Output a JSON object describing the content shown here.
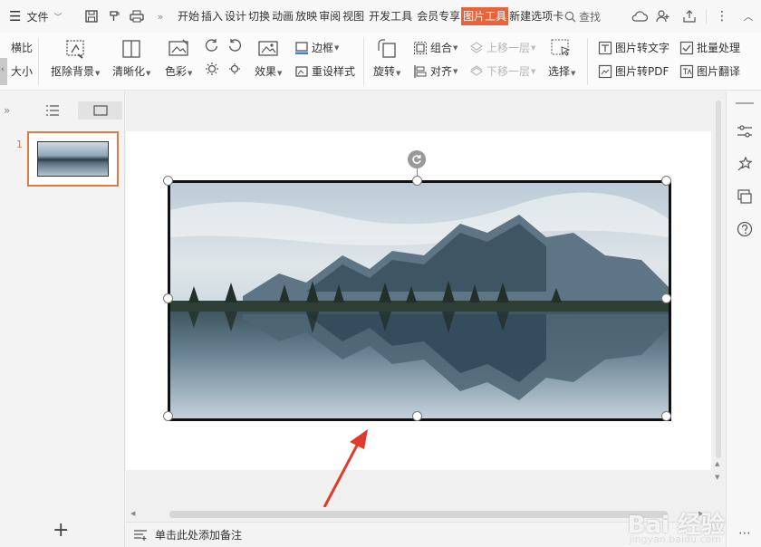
{
  "menubar": {
    "file_label": "文件",
    "tabs": [
      {
        "label": "开始"
      },
      {
        "label": "插入"
      },
      {
        "label": "设计"
      },
      {
        "label": "切换"
      },
      {
        "label": "动画"
      },
      {
        "label": "放映"
      },
      {
        "label": "审阅"
      },
      {
        "label": "视图"
      },
      {
        "label": "开发工具"
      },
      {
        "label": "会员专享"
      },
      {
        "label": "图片工具"
      },
      {
        "label": "新建选项卡"
      }
    ],
    "search_label": "查找"
  },
  "ribbon": {
    "crop_top": "横比",
    "crop_bottom": "大小",
    "remove_bg": "抠除背景",
    "sharpen": "清晰化",
    "color": "色彩",
    "effects": "效果",
    "border": "边框",
    "reset_style": "重设样式",
    "rotate": "旋转",
    "group": "组合",
    "align": "对齐",
    "bring_forward": "上移一层",
    "send_backward": "下移一层",
    "select": "选择",
    "pic_to_text": "图片转文字",
    "pic_to_pdf": "图片转PDF",
    "batch": "批量处理",
    "translate": "图片翻译"
  },
  "leftpanel": {
    "slide_number": "1"
  },
  "notes": {
    "placeholder": "单击此处添加备注"
  },
  "watermark": {
    "brand": "Bai 经验",
    "url": "jingyan.baidu.com"
  },
  "colors": {
    "accent": "#e8623a",
    "thumb_border": "#e27a3f",
    "annotation_arrow": "#e03a2a"
  }
}
